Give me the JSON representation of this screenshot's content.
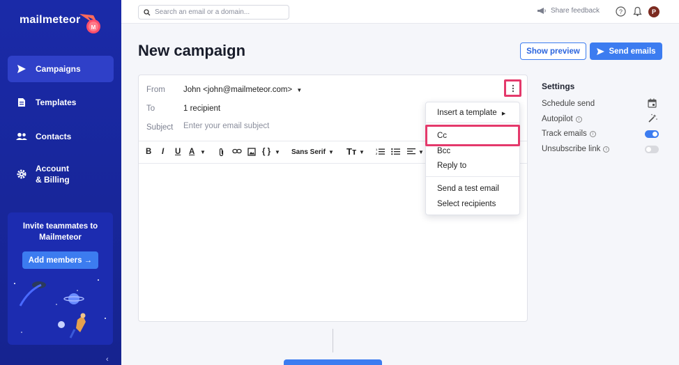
{
  "sidebar": {
    "logo_text": "mailmeteor",
    "nav": [
      {
        "label": "Campaigns",
        "icon": "send-icon",
        "active": true
      },
      {
        "label": "Templates",
        "icon": "document-icon"
      },
      {
        "label": "Contacts",
        "icon": "people-icon"
      },
      {
        "label_line1": "Account",
        "label_line2": "& Billing",
        "icon": "gear-icon"
      }
    ],
    "invite": {
      "title_line1": "Invite teammates to",
      "title_line2": "Mailmeteor",
      "button": "Add members →"
    },
    "collapse_glyph": "‹"
  },
  "topbar": {
    "search_placeholder": "Search an email or a domain...",
    "feedback": "Share feedback",
    "avatar_initial": "P"
  },
  "header": {
    "title": "New campaign",
    "preview_button": "Show preview",
    "send_button": "Send emails"
  },
  "composer": {
    "from_label": "From",
    "from_value": "John <john@mailmeteor.com>",
    "to_label": "To",
    "to_value": "1 recipient",
    "subject_label": "Subject",
    "subject_placeholder": "Enter your email subject",
    "toolbar": {
      "bold": "B",
      "italic": "I",
      "underline": "U",
      "text_color": "A",
      "variables": "{ }",
      "font": "Sans Serif",
      "size": "Tт"
    }
  },
  "menu": {
    "insert_template": "Insert a template",
    "cc": "Cc",
    "bcc": "Bcc",
    "reply_to": "Reply to",
    "send_test": "Send a test email",
    "select_recipients": "Select recipients"
  },
  "settings": {
    "title": "Settings",
    "schedule": "Schedule send",
    "autopilot": "Autopilot",
    "track": "Track emails",
    "track_on": true,
    "unsubscribe": "Unsubscribe link",
    "unsubscribe_on": false
  },
  "colors": {
    "sidebar": "#1a2aa8",
    "accent": "#3c7cf0",
    "highlight": "#e4396b"
  }
}
